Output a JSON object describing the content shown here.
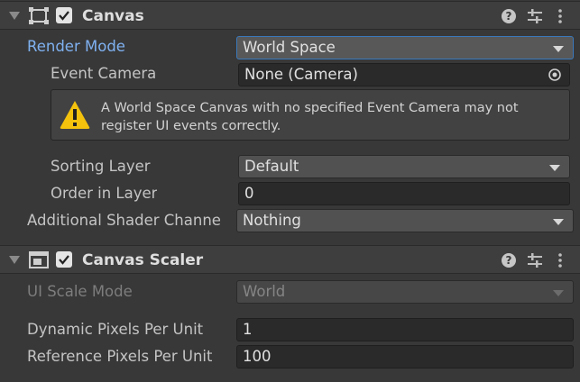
{
  "canvas": {
    "title": "Canvas",
    "enabled": true,
    "icon": "canvas-component-icon",
    "render_mode": {
      "label": "Render Mode",
      "value": "World Space"
    },
    "event_camera": {
      "label": "Event Camera",
      "value": "None (Camera)"
    },
    "warning": {
      "icon": "warning-icon",
      "text": "A World Space Canvas with no specified Event Camera may not register UI events correctly."
    },
    "sorting_layer": {
      "label": "Sorting Layer",
      "value": "Default"
    },
    "order_in_layer": {
      "label": "Order in Layer",
      "value": "0"
    },
    "additional_shader_channels": {
      "label": "Additional Shader Channe",
      "value": "Nothing"
    }
  },
  "canvas_scaler": {
    "title": "Canvas Scaler",
    "enabled": true,
    "icon": "canvas-scaler-icon",
    "ui_scale_mode": {
      "label": "UI Scale Mode",
      "value": "World"
    },
    "dynamic_pixels_per_unit": {
      "label": "Dynamic Pixels Per Unit",
      "value": "1"
    },
    "reference_pixels_per_unit": {
      "label": "Reference Pixels Per Unit",
      "value": "100"
    }
  },
  "colors": {
    "background": "#383838",
    "highlight_label": "#7fb1f0",
    "warning": "#f4c20d"
  }
}
